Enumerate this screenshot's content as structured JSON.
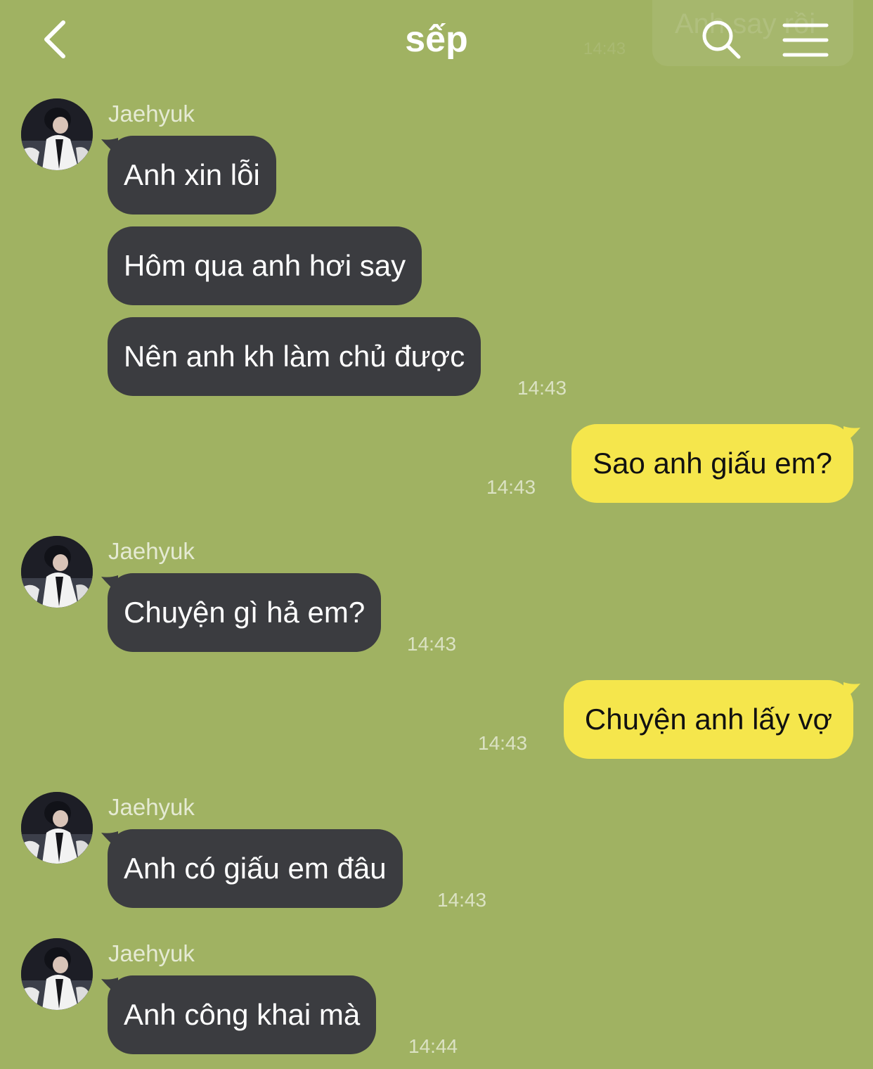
{
  "header": {
    "title": "sếp",
    "ghost_notification": {
      "text": "Anh say rồi",
      "time": "14:43"
    },
    "colors": {
      "background": "#a0b262",
      "title": "#ffffff"
    },
    "icons": [
      "back-chevron-icon",
      "search-icon",
      "menu-icon"
    ]
  },
  "chat": {
    "colors": {
      "incoming_bubble": "#3b3c40",
      "outgoing_bubble": "#f5e64c"
    },
    "messages": [
      {
        "sender": "Jaehyuk",
        "texts": [
          "Anh xin lỗi",
          "Hôm qua anh hơi say",
          "Nên anh kh làm chủ được"
        ],
        "time": "14:43"
      },
      {
        "text": "Sao anh giấu em?",
        "time": "14:43"
      },
      {
        "sender": "Jaehyuk",
        "texts": [
          "Chuyện gì hả em?"
        ],
        "time": "14:43"
      },
      {
        "text": "Chuyện anh lấy vợ",
        "time": "14:43"
      },
      {
        "sender": "Jaehyuk",
        "texts": [
          "Anh có giấu em đâu"
        ],
        "time": "14:43"
      },
      {
        "sender": "Jaehyuk",
        "texts": [
          "Anh công khai mà"
        ],
        "time": "14:44"
      }
    ]
  }
}
